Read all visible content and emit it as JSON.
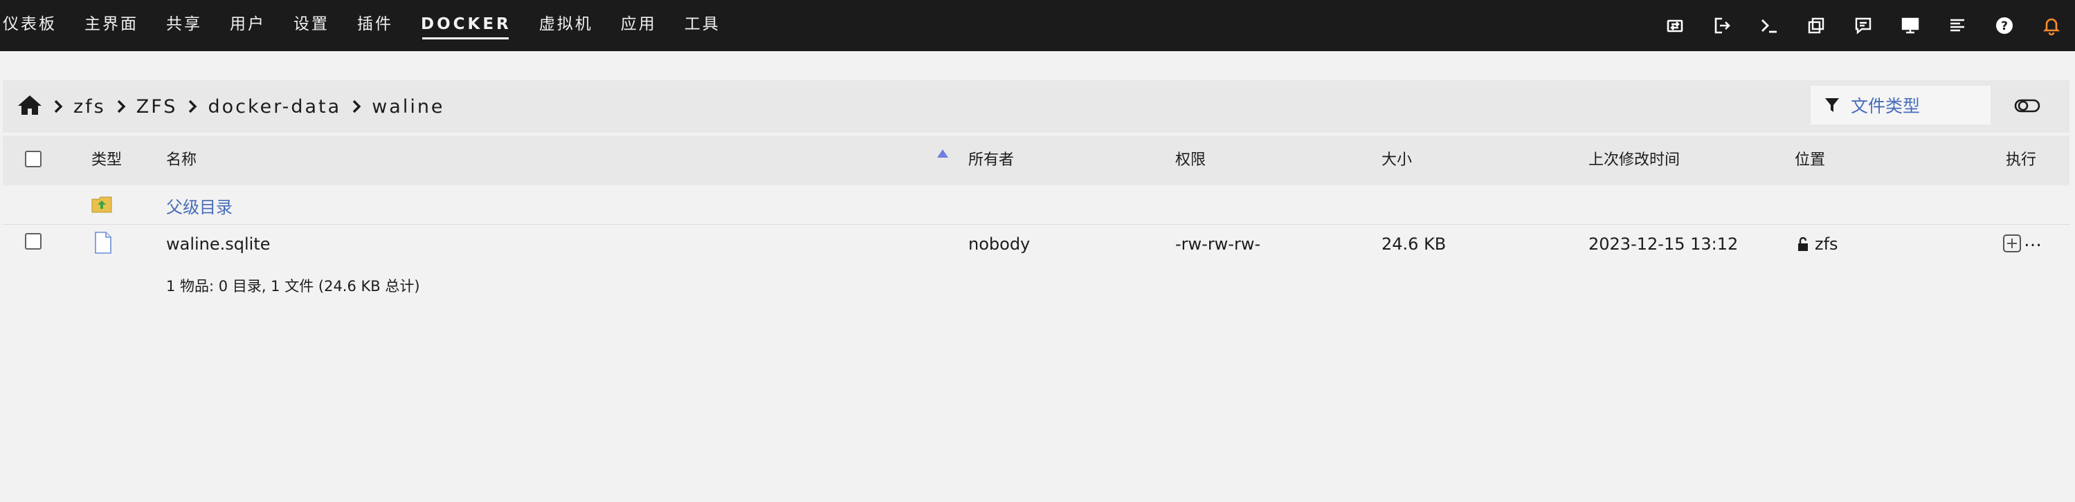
{
  "nav": {
    "items": [
      "仪表板",
      "主界面",
      "共享",
      "用户",
      "设置",
      "插件",
      "DOCKER",
      "虚拟机",
      "应用",
      "工具"
    ],
    "active": "DOCKER"
  },
  "toolbar": {
    "icons": [
      "transfer-icon",
      "logout-icon",
      "terminal-icon",
      "copy-icon",
      "feedback-icon",
      "monitor-icon",
      "log-icon",
      "help-icon",
      "bell-icon"
    ]
  },
  "breadcrumb": {
    "items": [
      "zfs",
      "ZFS",
      "docker-data",
      "waline"
    ]
  },
  "filter": {
    "placeholder": "文件类型"
  },
  "table": {
    "headers": {
      "type": "类型",
      "name": "名称",
      "owner": "所有者",
      "perm": "权限",
      "size": "大小",
      "modified": "上次修改时间",
      "location": "位置",
      "action": "执行"
    },
    "parent": {
      "label": "父级目录"
    },
    "rows": [
      {
        "name": "waline.sqlite",
        "owner": "nobody",
        "perm": "-rw-rw-rw-",
        "size": "24.6 KB",
        "modified": "2023-12-15 13:12",
        "location": "zfs",
        "action": "…"
      }
    ],
    "summary": "1 物品: 0 目录, 1 文件 (24.6 KB 总计)"
  },
  "colors": {
    "topbar": "#1c1b1b",
    "link": "#486dba",
    "bell": "#ff8c2f",
    "sort": "#6f7fe0"
  }
}
